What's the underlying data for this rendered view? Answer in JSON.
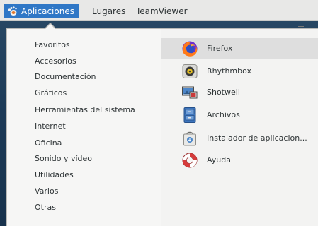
{
  "panel": {
    "applications_label": "Aplicaciones",
    "places_label": "Lugares",
    "teamviewer_label": "TeamViewer"
  },
  "categories": [
    "Favoritos",
    "Accesorios",
    "Documentación",
    "Gráficos",
    "Herramientas del sistema",
    "Internet",
    "Oficina",
    "Sonido y vídeo",
    "Utilidades",
    "Varios",
    "Otras"
  ],
  "apps": [
    {
      "label": "Firefox",
      "icon": "firefox-icon"
    },
    {
      "label": "Rhythmbox",
      "icon": "rhythmbox-icon"
    },
    {
      "label": "Shotwell",
      "icon": "shotwell-icon"
    },
    {
      "label": "Archivos",
      "icon": "files-icon"
    },
    {
      "label": "Instalador de aplicacion...",
      "icon": "software-installer-icon"
    },
    {
      "label": "Ayuda",
      "icon": "help-icon"
    }
  ],
  "colors": {
    "accent": "#2f77c6",
    "panel_bg": "#e8e8e7",
    "menu_bg": "#f6f6f5",
    "hover_bg": "#dedede"
  }
}
